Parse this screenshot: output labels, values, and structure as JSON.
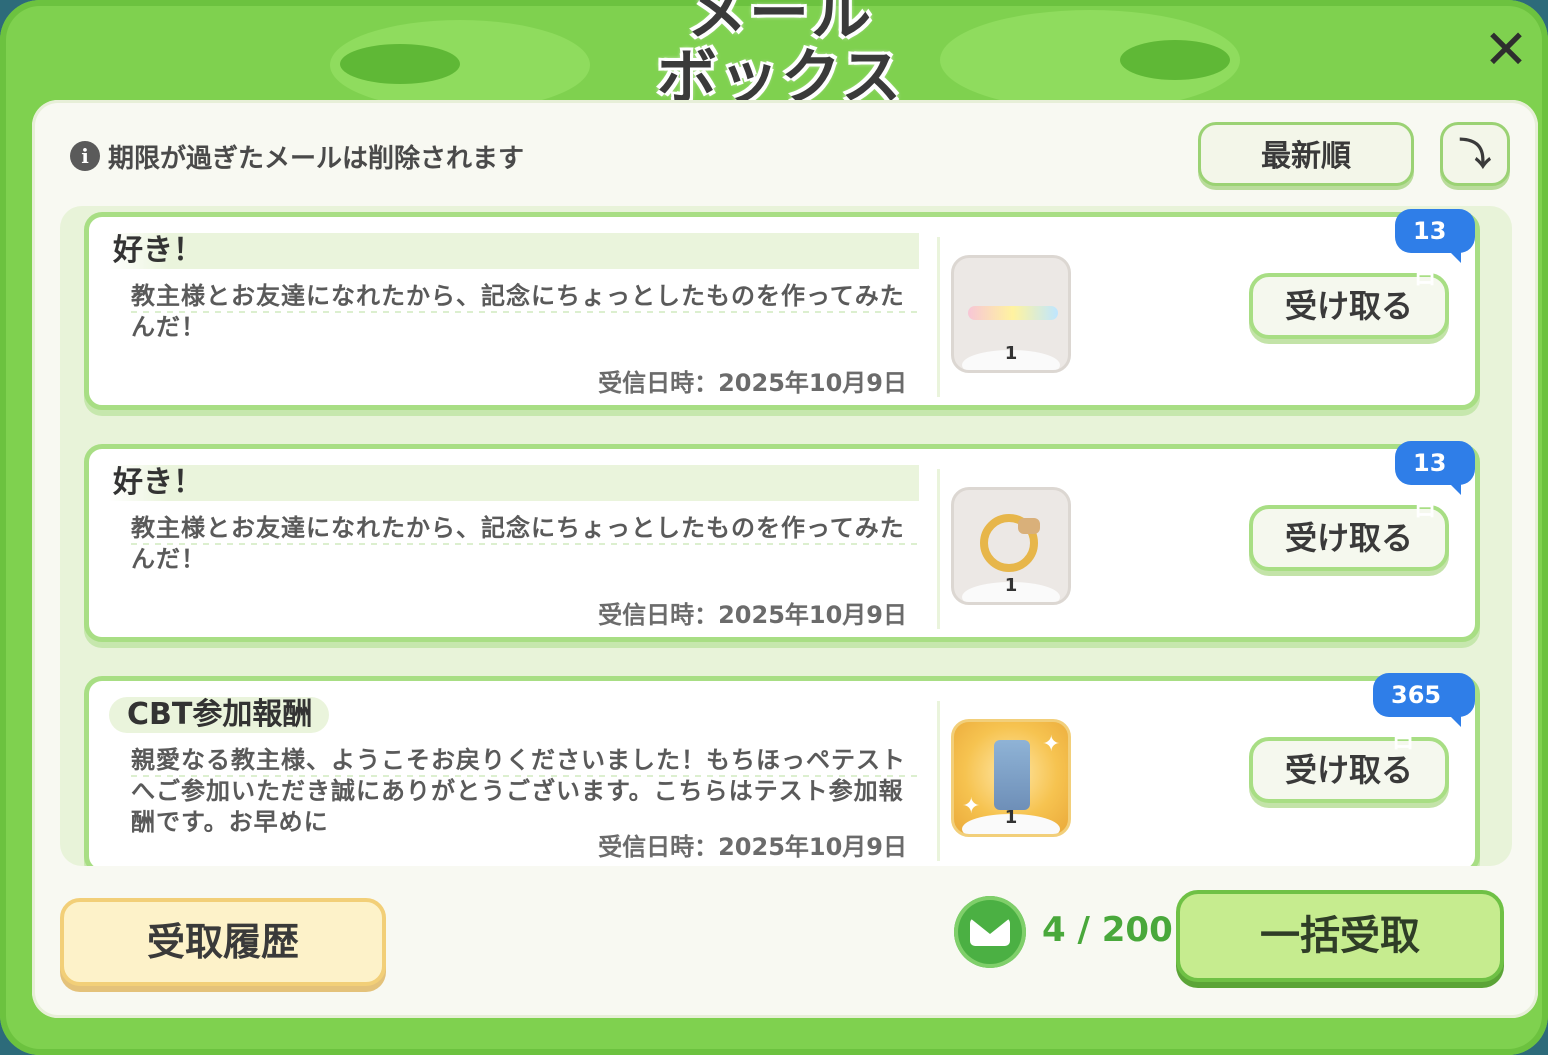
{
  "header": {
    "title_line1": "メール",
    "title_line2": "ボックス",
    "close_label": "✕"
  },
  "notice": {
    "info_icon": "i",
    "text": "期限が過ぎたメールは削除されます"
  },
  "sort": {
    "label": "最新順",
    "order_icon": "⤵"
  },
  "mails": [
    {
      "title": "好き！",
      "body": "教主様とお友達になれたから、記念にちょっとしたものを作ってみたんだ！",
      "date": "受信日時：2025年10月9日",
      "days_left": "13日",
      "item_qty": "1",
      "item_icon": "ribbon-icon",
      "receive_label": "受け取る"
    },
    {
      "title": "好き！",
      "body": "教主様とお友達になれたから、記念にちょっとしたものを作ってみたんだ！",
      "date": "受信日時：2025年10月9日",
      "days_left": "13日",
      "item_qty": "1",
      "item_icon": "ring-icon",
      "receive_label": "受け取る"
    },
    {
      "title": "CBT参加報酬",
      "body": "親愛なる教主様、ようこそお戻りくださいました！もちほっペテストへご参加いただき誠にありがとうございます。こちらはテスト参加報酬です。お早めに",
      "date": "受信日時：2025年10月9日",
      "days_left": "365日",
      "item_qty": "1",
      "item_icon": "cbt-trophy-icon",
      "receive_label": "受け取る"
    }
  ],
  "footer": {
    "history_label": "受取履歴",
    "mail_count": "4 / 200",
    "bulk_label": "一括受取"
  },
  "colors": {
    "frame_green": "#7fd14f",
    "badge_blue": "#2f7ee8",
    "history_yellow": "#fdf2c9",
    "bulk_green": "#c6ec8f"
  }
}
